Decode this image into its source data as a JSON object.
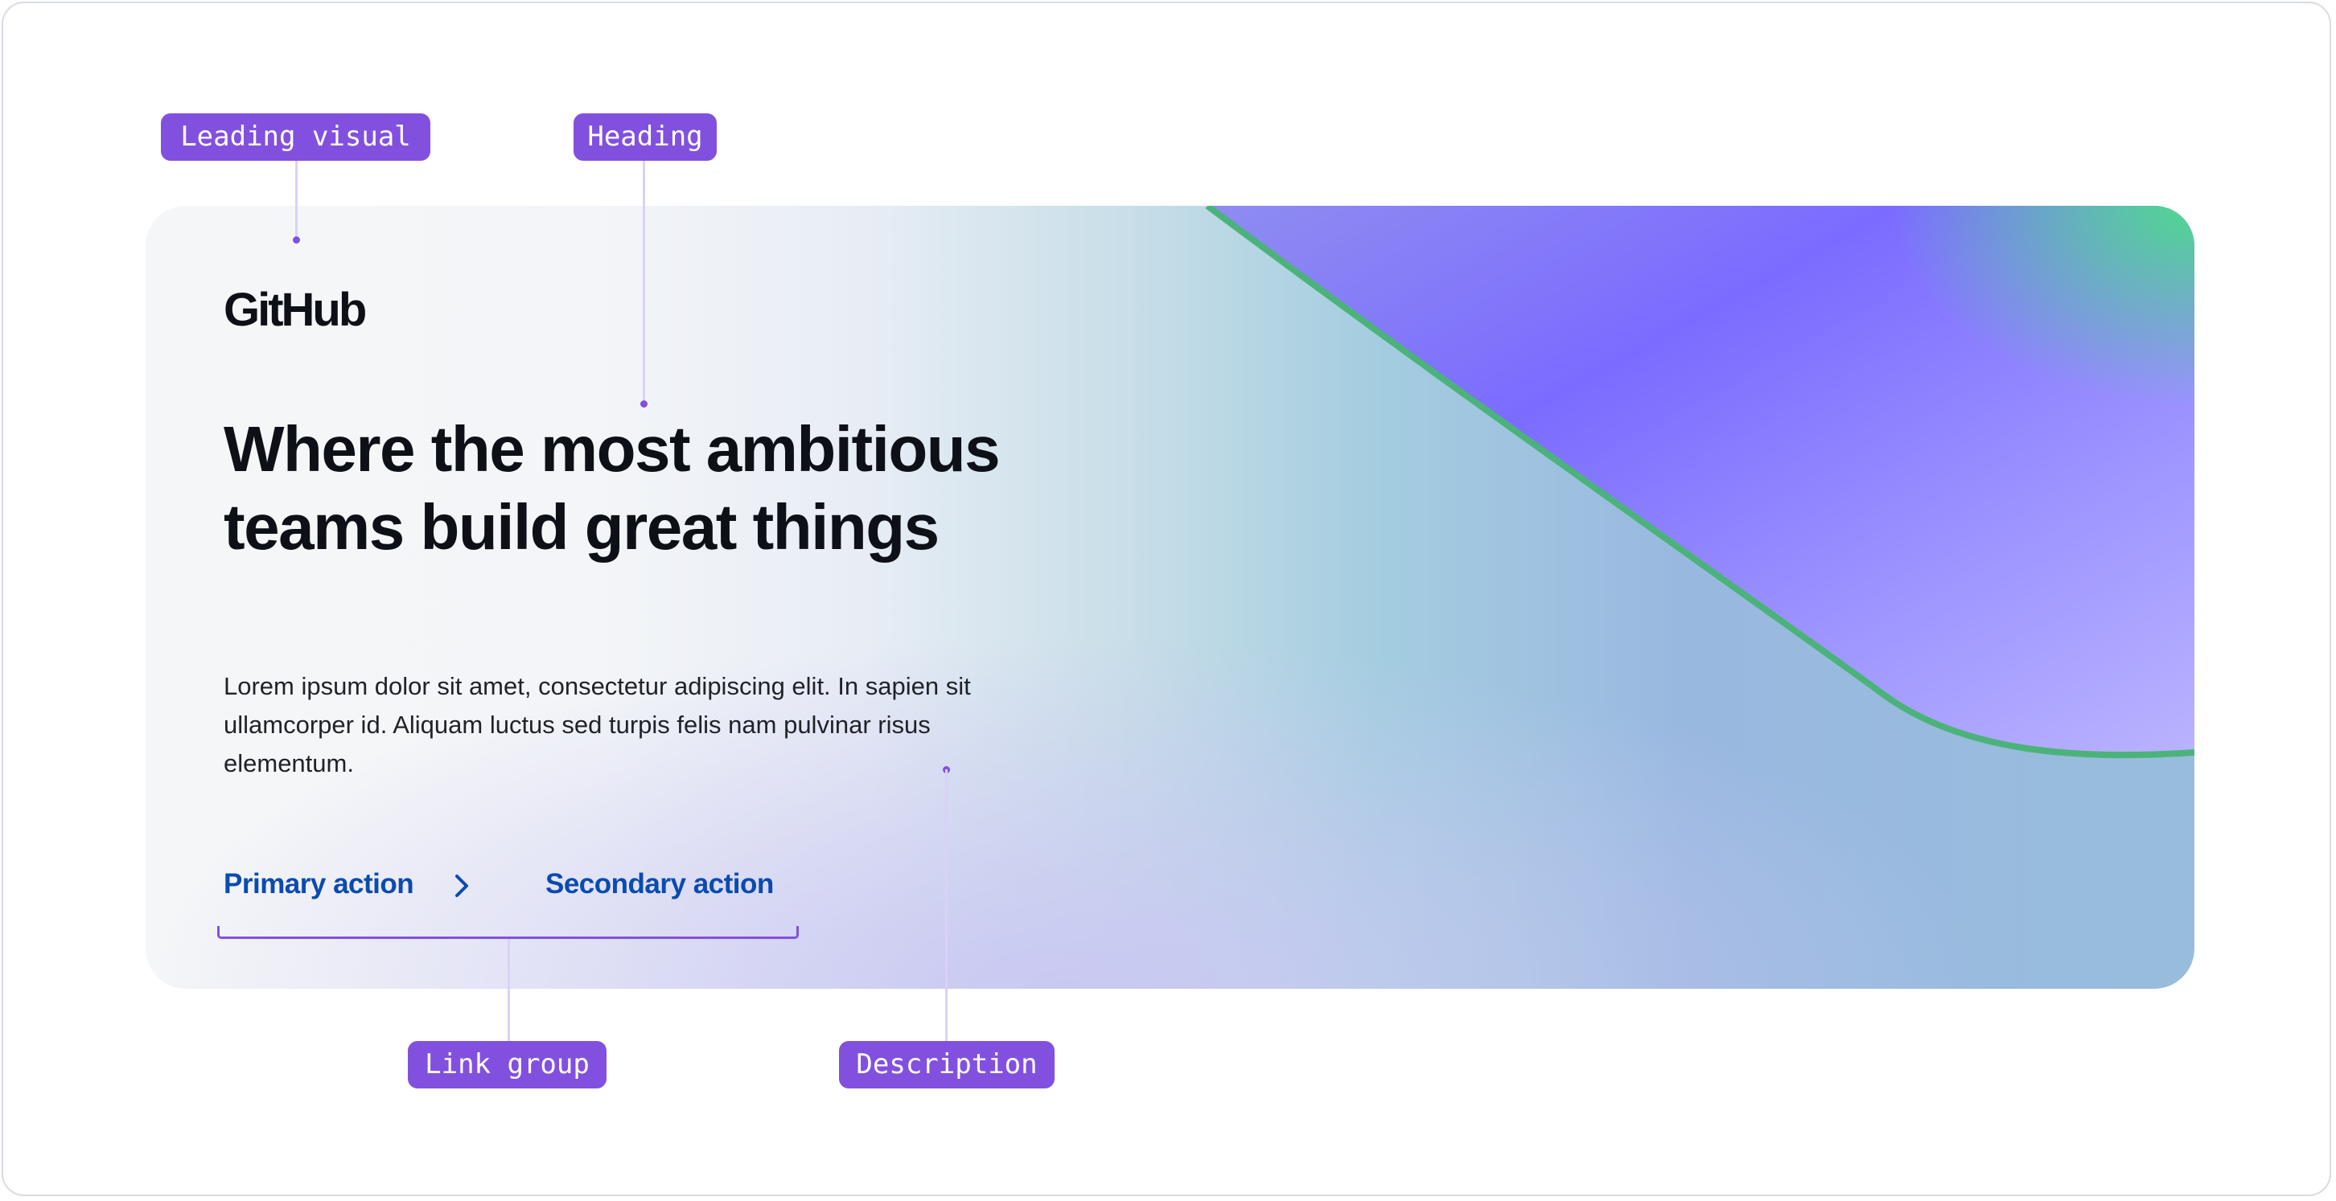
{
  "annotations": {
    "leading_visual": "Leading visual",
    "heading": "Heading",
    "link_group": "Link group",
    "description": "Description"
  },
  "hero": {
    "logo": "GitHub",
    "heading": "Where the most ambitious teams build great things",
    "description": "Lorem ipsum dolor sit amet, consectetur adipiscing elit. In sapien sit ullamcorper id. Aliquam luctus sed turpis felis nam pulvinar risus elementum.",
    "primary_action": "Primary action",
    "secondary_action": "Secondary action"
  },
  "colors": {
    "annotation": "#8250df",
    "link": "#0a4bb0",
    "text": "#0d1117"
  }
}
